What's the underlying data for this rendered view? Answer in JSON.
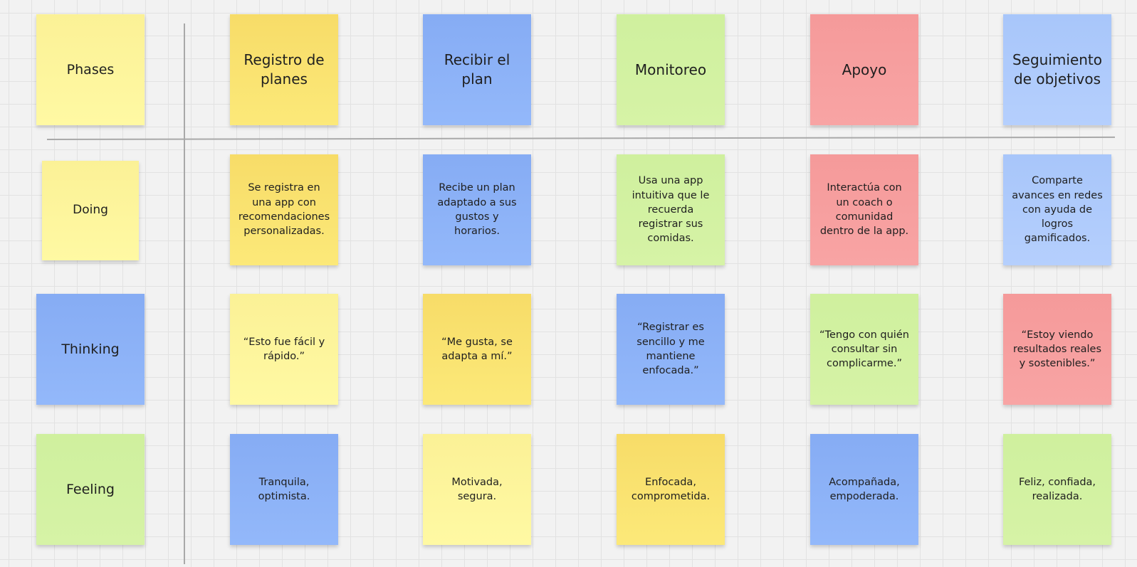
{
  "rows": {
    "phases": "Phases",
    "doing": "Doing",
    "thinking": "Thinking",
    "feeling": "Feeling"
  },
  "phases": [
    "Registro de planes",
    "Recibir el plan",
    "Monitoreo",
    "Apoyo",
    "Seguimiento de objetivos"
  ],
  "doing": [
    "Se registra en una app con recomendaciones personalizadas.",
    "Recibe un plan adaptado a sus gustos y horarios.",
    "Usa una app intuitiva que le recuerda registrar sus comidas.",
    "Interactúa con un coach o comunidad dentro de la app.",
    "Comparte avances en redes con ayuda de logros gamificados."
  ],
  "thinking": [
    "“Esto fue fácil y rápido.”",
    "“Me gusta, se adapta a mí.”",
    "“Registrar es sencillo y me mantiene enfocada.”",
    "“Tengo con quién consultar sin complicarme.”",
    "“Estoy viendo resultados reales y sostenibles.”"
  ],
  "feeling": [
    "Tranquila, optimista.",
    "Motivada, segura.",
    "Enfocada, comprometida.",
    "Acompañada, empoderada.",
    "Feliz, confiada, realizada."
  ],
  "colors": {
    "light_yellow": "#fff9a3",
    "yellow": "#fce979",
    "blue": "#8fb4f7",
    "light_blue": "#b3cdfc",
    "green": "#d4f2a3",
    "red": "#f7a0a0",
    "divider": "#a9a9a9",
    "canvas": "#f2f2f2"
  }
}
